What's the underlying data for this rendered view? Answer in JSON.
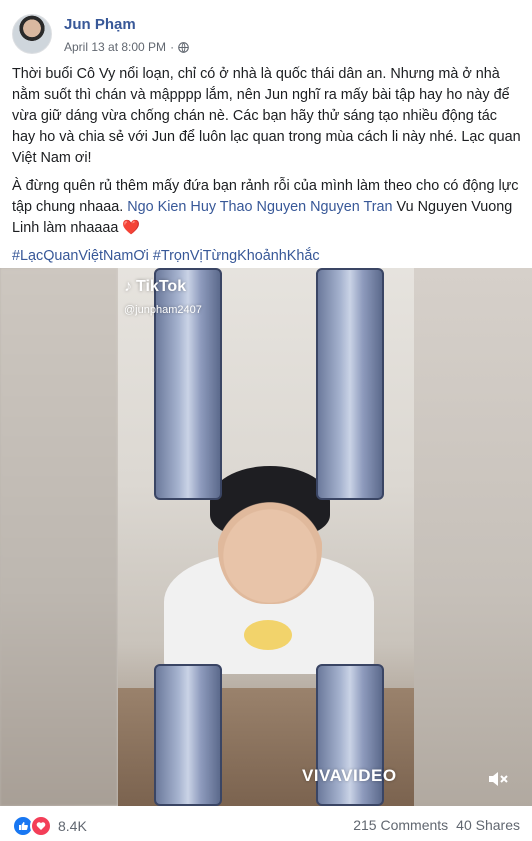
{
  "post": {
    "author": "Jun Phạm",
    "date": "April 13 at 8:00 PM",
    "separator": "·",
    "paragraph1": "Thời buổi Cô Vy nổi loạn, chỉ có ở nhà là quốc thái dân an. Nhưng mà ở nhà nằm suốt thì chán và mậpppp lắm, nên Jun nghĩ ra mấy bài tập hay ho này để vừa giữ dáng vừa chống chán nè. Các bạn hãy thử sáng tạo nhiều động tác hay ho và chia sẻ với Jun để luôn lạc quan trong mùa cách li này nhé. Lạc quan Việt Nam ơi!",
    "paragraph2_text": "À đừng quên rủ thêm mấy đứa bạn rảnh rỗi của mình làm theo cho có động lực tập chung nhaaa. ",
    "paragraph2_tags": "Ngo Kien Huy Thao Nguyen Nguyen Tran",
    "paragraph2_tail": " Vu Nguyen Vuong Linh làm nhaaaa ",
    "heart": "❤️",
    "hashtags": "#LạcQuanViệtNamƠi #TrọnVịTừngKhoảnhKhắc"
  },
  "video": {
    "tiktok_label": "TikTok",
    "tiktok_note": "♪",
    "handle": "@junpham2407",
    "watermark": "VIVAVIDEO"
  },
  "footer": {
    "reaction_count": "8.4K",
    "comments": "215 Comments",
    "shares": "40 Shares"
  },
  "colors": {
    "link": "#385898",
    "like": "#1877f2",
    "love": "#f33e58"
  }
}
